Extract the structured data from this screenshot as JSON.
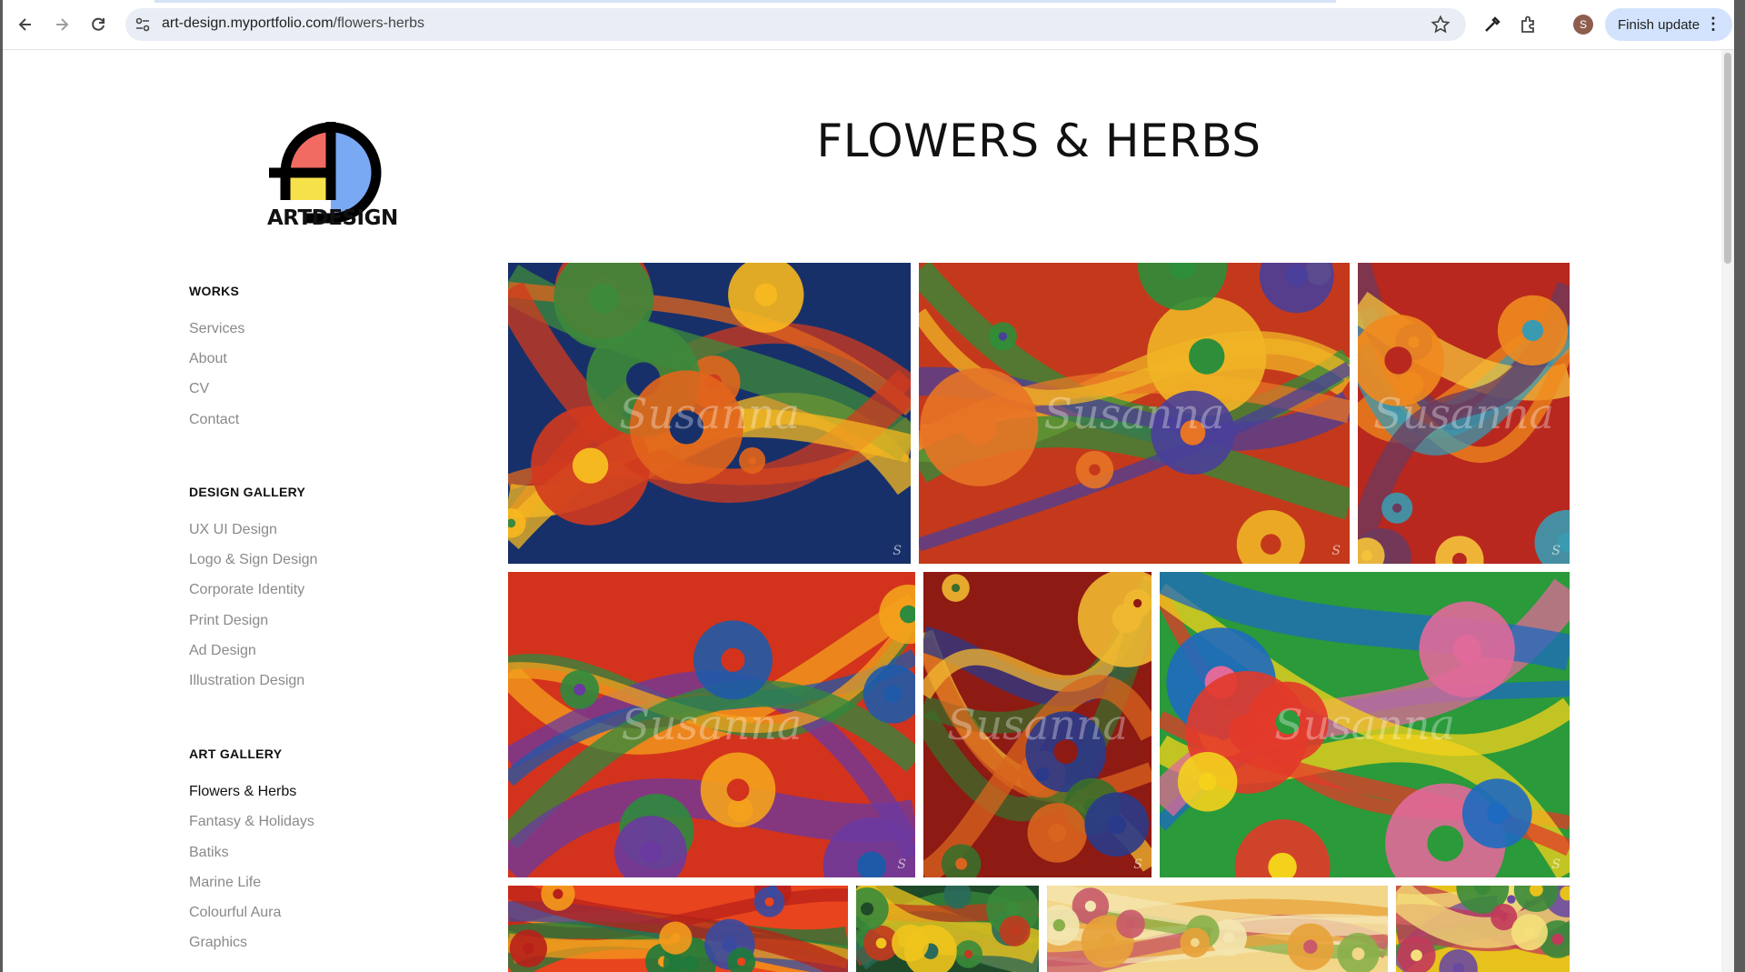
{
  "browser": {
    "url_host": "art-design.myportfolio.com",
    "url_path": "/flowers-herbs",
    "profile_initial": "S",
    "update_label": "Finish update"
  },
  "brand": {
    "logo_text": "ARTDESIGN"
  },
  "page": {
    "title": "FLOWERS & HERBS"
  },
  "nav": {
    "works": {
      "heading": "WORKS",
      "items": [
        "Services",
        "About",
        "CV",
        "Contact"
      ]
    },
    "design_gallery": {
      "heading": "DESIGN GALLERY",
      "items": [
        "UX UI Design",
        "Logo & Sign Design",
        "Corporate Identity",
        "Print Design",
        "Ad Design",
        "Illustration Design"
      ]
    },
    "art_gallery": {
      "heading": "ART GALLERY",
      "items": [
        "Flowers & Herbs",
        "Fantasy & Holidays",
        "Batiks",
        "Marine Life",
        "Colourful Aura",
        "Graphics"
      ],
      "active": "Flowers & Herbs"
    }
  },
  "gallery": {
    "watermark": "Susanna",
    "signature": "S",
    "tiles": [
      {
        "name": "gerbera-daisies-painting",
        "palette": [
          "#18306a",
          "#e2651c",
          "#d13a1e",
          "#f6b820",
          "#3d8a3b"
        ]
      },
      {
        "name": "wildflower-field-painting",
        "palette": [
          "#c4391b",
          "#f0b526",
          "#2f8e3a",
          "#4a3f9a",
          "#e87426"
        ]
      },
      {
        "name": "fruit-still-life-painting",
        "palette": [
          "#b8281e",
          "#f08a1e",
          "#3a9ab0",
          "#6b3a5e",
          "#f5c33a"
        ]
      },
      {
        "name": "tropical-leaves-painting",
        "palette": [
          "#d3331c",
          "#f4a21c",
          "#2e8a3e",
          "#6a3aa0",
          "#1f5aa8"
        ]
      },
      {
        "name": "tulip-bouquet-painting",
        "palette": [
          "#8e1a14",
          "#f0b830",
          "#3a6e2a",
          "#d8641e",
          "#2a3a8a"
        ]
      },
      {
        "name": "hibiscus-jungle-painting",
        "palette": [
          "#2a9a3a",
          "#e23a2a",
          "#f4d21c",
          "#1e6ac0",
          "#e06a9a"
        ]
      },
      {
        "name": "red-roses-painting",
        "palette": [
          "#e8441e",
          "#1e7a3a",
          "#f49a1c",
          "#b8201a",
          "#3a4aa0"
        ]
      },
      {
        "name": "green-foliage-painting",
        "palette": [
          "#1e4a2a",
          "#3a8a3a",
          "#c23a1e",
          "#f0c41c",
          "#2a6a5a"
        ]
      },
      {
        "name": "foxglove-garden-painting",
        "palette": [
          "#f2d68a",
          "#e8a23a",
          "#c85a6a",
          "#f4e6b0",
          "#8ab04a"
        ]
      },
      {
        "name": "yellow-meadow-painting",
        "palette": [
          "#e8c21c",
          "#3a8a3a",
          "#c23a5a",
          "#f4e07a",
          "#6a4aa0"
        ]
      }
    ]
  }
}
